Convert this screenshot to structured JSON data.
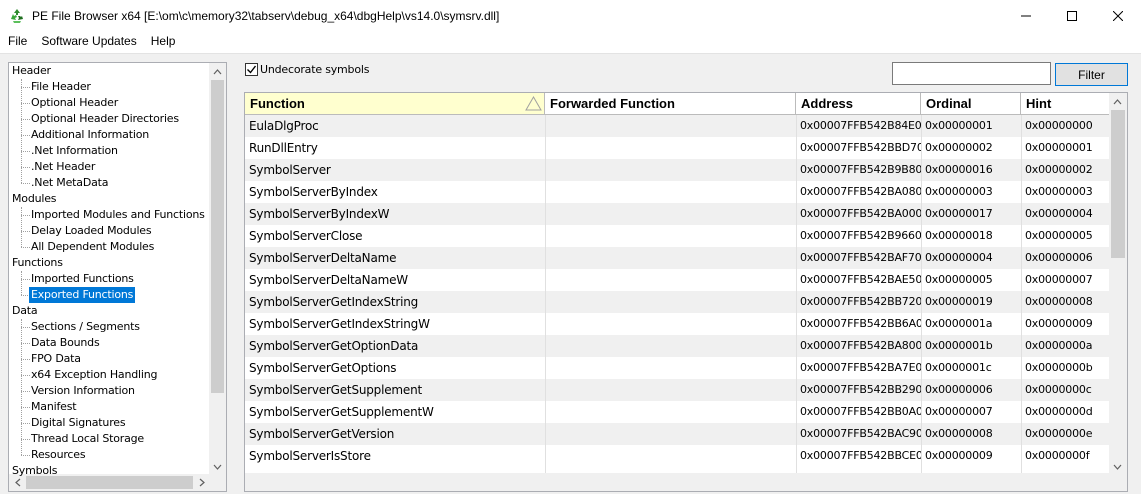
{
  "window": {
    "title": "PE File Browser x64 [E:\\om\\c\\memory32\\tabserv\\debug_x64\\dbgHelp\\vs14.0\\symsrv.dll]",
    "app_icon": "recycle-icon"
  },
  "menu": {
    "file": "File",
    "updates": "Software Updates",
    "help": "Help"
  },
  "tree": {
    "items": [
      {
        "label": "Header",
        "level": 0
      },
      {
        "label": "File Header",
        "level": 1
      },
      {
        "label": "Optional Header",
        "level": 1
      },
      {
        "label": "Optional Header Directories",
        "level": 1
      },
      {
        "label": "Additional Information",
        "level": 1
      },
      {
        "label": ".Net Information",
        "level": 1
      },
      {
        "label": ".Net Header",
        "level": 1
      },
      {
        "label": ".Net MetaData",
        "level": 1
      },
      {
        "label": "Modules",
        "level": 0
      },
      {
        "label": "Imported Modules and Functions",
        "level": 1
      },
      {
        "label": "Delay Loaded Modules",
        "level": 1
      },
      {
        "label": "All Dependent Modules",
        "level": 1
      },
      {
        "label": "Functions",
        "level": 0
      },
      {
        "label": "Imported Functions",
        "level": 1
      },
      {
        "label": "Exported Functions",
        "level": 1,
        "selected": true
      },
      {
        "label": "Data",
        "level": 0
      },
      {
        "label": "Sections / Segments",
        "level": 1
      },
      {
        "label": "Data Bounds",
        "level": 1
      },
      {
        "label": "FPO Data",
        "level": 1
      },
      {
        "label": "x64 Exception Handling",
        "level": 1
      },
      {
        "label": "Version Information",
        "level": 1
      },
      {
        "label": "Manifest",
        "level": 1
      },
      {
        "label": "Digital Signatures",
        "level": 1
      },
      {
        "label": "Thread Local Storage",
        "level": 1
      },
      {
        "label": "Resources",
        "level": 1
      },
      {
        "label": "Symbols",
        "level": 0
      }
    ]
  },
  "options": {
    "undecorate_label": "Undecorate symbols",
    "undecorate_checked": true
  },
  "filter": {
    "value": "",
    "button_label": "Filter"
  },
  "grid": {
    "columns": [
      "Function",
      "Forwarded Function",
      "Address",
      "Ordinal",
      "Hint"
    ],
    "sorted_column": "Function",
    "rows": [
      [
        "EulaDlgProc",
        "",
        "0x00007FFB542B84E0",
        "0x00000001",
        "0x00000000"
      ],
      [
        "RunDllEntry",
        "",
        "0x00007FFB542BBD70",
        "0x00000002",
        "0x00000001"
      ],
      [
        "SymbolServer",
        "",
        "0x00007FFB542B9B80",
        "0x00000016",
        "0x00000002"
      ],
      [
        "SymbolServerByIndex",
        "",
        "0x00007FFB542BA080",
        "0x00000003",
        "0x00000003"
      ],
      [
        "SymbolServerByIndexW",
        "",
        "0x00007FFB542BA000",
        "0x00000017",
        "0x00000004"
      ],
      [
        "SymbolServerClose",
        "",
        "0x00007FFB542B9660",
        "0x00000018",
        "0x00000005"
      ],
      [
        "SymbolServerDeltaName",
        "",
        "0x00007FFB542BAF70",
        "0x00000004",
        "0x00000006"
      ],
      [
        "SymbolServerDeltaNameW",
        "",
        "0x00007FFB542BAE50",
        "0x00000005",
        "0x00000007"
      ],
      [
        "SymbolServerGetIndexString",
        "",
        "0x00007FFB542BB720",
        "0x00000019",
        "0x00000008"
      ],
      [
        "SymbolServerGetIndexStringW",
        "",
        "0x00007FFB542BB6A0",
        "0x0000001a",
        "0x00000009"
      ],
      [
        "SymbolServerGetOptionData",
        "",
        "0x00007FFB542BA800",
        "0x0000001b",
        "0x0000000a"
      ],
      [
        "SymbolServerGetOptions",
        "",
        "0x00007FFB542BA7E0",
        "0x0000001c",
        "0x0000000b"
      ],
      [
        "SymbolServerGetSupplement",
        "",
        "0x00007FFB542BB290",
        "0x00000006",
        "0x0000000c"
      ],
      [
        "SymbolServerGetSupplementW",
        "",
        "0x00007FFB542BB0A0",
        "0x00000007",
        "0x0000000d"
      ],
      [
        "SymbolServerGetVersion",
        "",
        "0x00007FFB542BAC90",
        "0x00000008",
        "0x0000000e"
      ],
      [
        "SymbolServerIsStore",
        "",
        "0x00007FFB542BBCE0",
        "0x00000009",
        "0x0000000f"
      ]
    ]
  },
  "colors": {
    "selection": "#0078d7",
    "sorted_header": "#ffffcf",
    "alt_row": "#f0f0f0"
  }
}
